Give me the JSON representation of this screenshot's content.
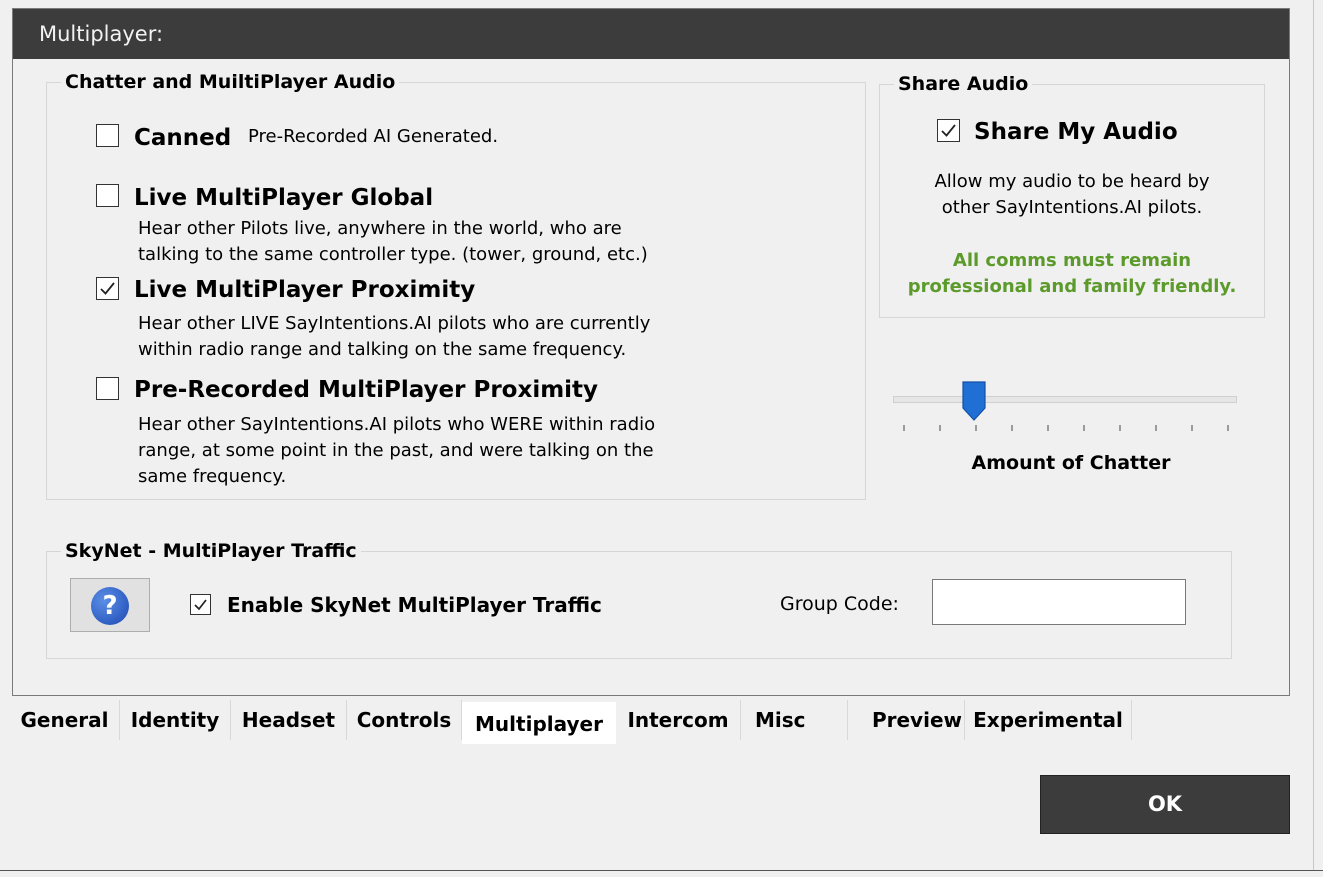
{
  "header": {
    "title": "Multiplayer:"
  },
  "chatter": {
    "legend": "Chatter and MuiltiPlayer Audio",
    "options": [
      {
        "title": "Canned",
        "inline_desc": "Pre-Recorded AI Generated.",
        "checked": false
      },
      {
        "title": "Live MultiPlayer Global",
        "desc": "Hear other Pilots live, anywhere in the world, who are\ntalking to the same controller type. (tower, ground, etc.)",
        "checked": false
      },
      {
        "title": "Live MultiPlayer Proximity",
        "desc": "Hear other LIVE SayIntentions.AI pilots who are currently\nwithin radio range and talking on the same frequency.",
        "checked": true
      },
      {
        "title": "Pre-Recorded MultiPlayer Proximity",
        "desc": "Hear other SayIntentions.AI pilots who WERE within radio\nrange, at some point in the past, and were talking on the\nsame frequency.",
        "checked": false
      }
    ]
  },
  "share_audio": {
    "legend": "Share Audio",
    "checkbox_label": "Share My Audio",
    "checked": true,
    "description": "Allow my audio to be heard by\nother SayIntentions.AI pilots.",
    "warning": "All comms must remain\nprofessional and family friendly.",
    "warning_color": "#5b9a2b"
  },
  "chatter_slider": {
    "label": "Amount of Chatter",
    "value_fraction": 0.22,
    "tick_count": 10
  },
  "skynet": {
    "legend": "SkyNet - MultiPlayer Traffic",
    "help_icon": "question-mark-icon",
    "enable_label": "Enable SkyNet MultiPlayer Traffic",
    "enable_checked": true,
    "group_code_label": "Group Code:",
    "group_code_value": ""
  },
  "tabs": [
    "General",
    "Identity",
    "Headset",
    "Controls",
    "Multiplayer",
    "Intercom",
    "Misc",
    "Preview",
    "Experimental"
  ],
  "active_tab": "Multiplayer",
  "ok_label": "OK",
  "colors": {
    "header_bg": "#3c3c3c",
    "accent_blue": "#1b47b2"
  }
}
